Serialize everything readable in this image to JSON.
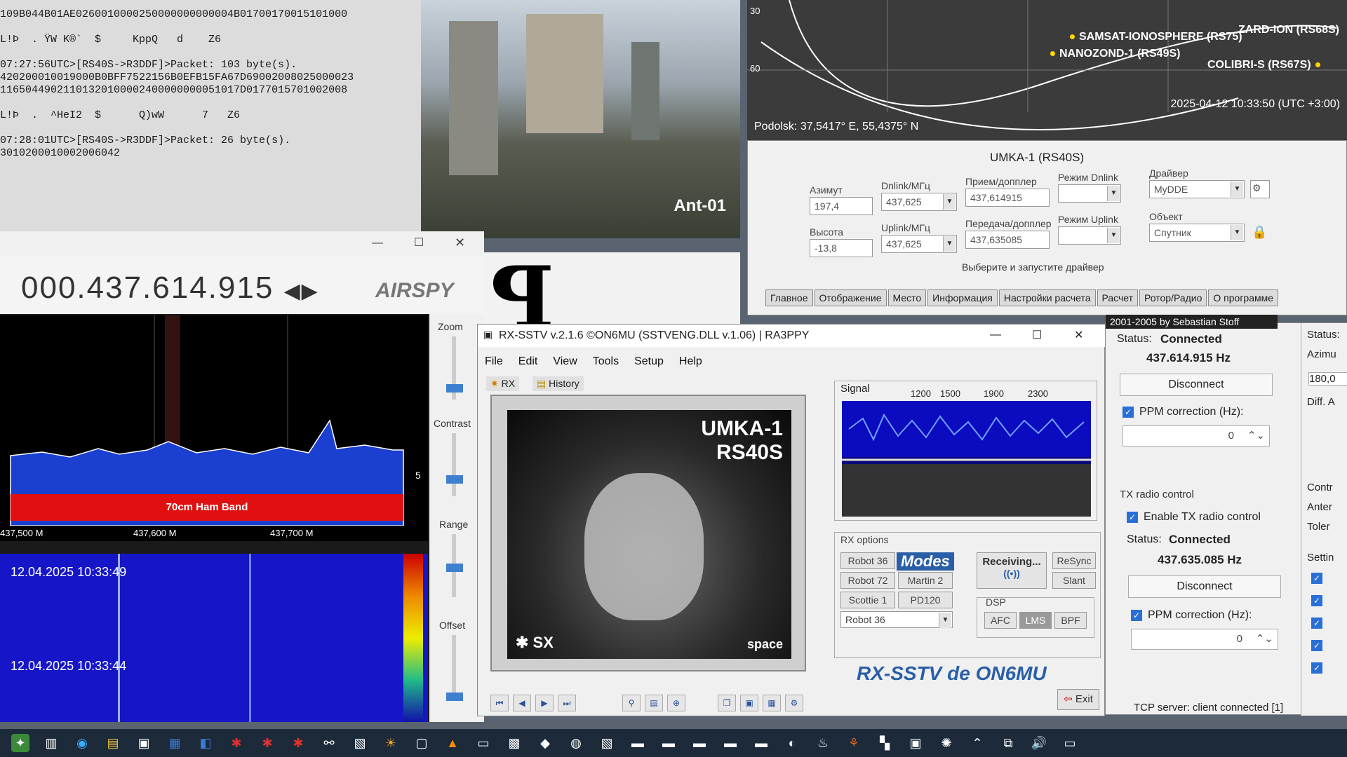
{
  "terminal": {
    "lines": [
      "109B044B01AE0260010000250000000000004B01700170015101000",
      "",
      "L!Þ  . ŸW K®`  $     KppQ   d    Z6",
      "",
      "07:27:56UTC>[RS40S->R3DDF]>Packet: 103 byte(s).",
      "420200010019000B0BFF7522156B0EFB15FA67D69002008025000023",
      "11650449021101320100002400000000051017D0177015701002008",
      "",
      "L!Þ  .  ^HeI2  $      Q)wW      7   Z6",
      "",
      "07:28:01UTC>[RS40S->R3DDF]>Packet: 26 byte(s).",
      "3010200010002006042"
    ]
  },
  "camera": {
    "label": "Ant-01"
  },
  "map": {
    "sats": [
      "SAMSAT-IONOSPHERE (RS75)",
      "NANOZOND-1 (RS49S)",
      "COLIBRI-S (RS67S)",
      "ZARD-ION (RS68S)"
    ],
    "axis_ticks": [
      "30",
      "60"
    ],
    "coords": "Podolsk: 37,5417° E, 55,4375° N",
    "timestamp": "2025-04-12 10:33:50 (UTC +3:00)"
  },
  "satpanel": {
    "title": "UMKA-1 (RS40S)",
    "azimuth_label": "Азимут",
    "azimuth": "197,4",
    "elevation_label": "Высота",
    "elevation": "-13,8",
    "dnlink_label": "Dnlink/МГц",
    "dnlink": "437,625",
    "uplink_label": "Uplink/МГц",
    "uplink": "437,625",
    "rx_doppler_label": "Прием/допплер",
    "rx_doppler": "437,614915",
    "tx_doppler_label": "Передача/допплер",
    "tx_doppler": "437,635085",
    "dn_mode_label": "Режим Dnlink",
    "up_mode_label": "Режим Uplink",
    "driver_label": "Драйвер",
    "driver": "MyDDE",
    "object_label": "Объект",
    "object": "Спутник",
    "hint": "Выберите и запустите драйвер",
    "tabs": [
      "Главное",
      "Отображение",
      "Место",
      "Информация",
      "Настройки расчета",
      "Расчет",
      "Ротор/Радио",
      "О программе"
    ]
  },
  "airspy": {
    "freq": "000.437.614.915",
    "logo": "AIRSPY",
    "axis": [
      "437,500 M",
      "437,600 M",
      "437,700 M"
    ],
    "band": "70cm Ham Band",
    "scale_right": "5",
    "wf_ts1": "12.04.2025 10:33:49",
    "wf_ts2": "12.04.2025 10:33:44",
    "controls": [
      "Zoom",
      "Contrast",
      "Range",
      "Offset"
    ]
  },
  "sstv": {
    "title": "RX-SSTV v.2.1.6 ©ON6MU (SSTVENG.DLL v.1.06) | RA3PPY",
    "menu": [
      "File",
      "Edit",
      "View",
      "Tools",
      "Setup",
      "Help"
    ],
    "rx": "RX",
    "history": "History",
    "img_line1": "UMKA-1",
    "img_line2": "RS40S",
    "img_sx": "SX",
    "img_space": "space",
    "signal_label": "Signal",
    "signal_ticks": [
      "1200",
      "1500",
      "1900",
      "2300"
    ],
    "rx_options": "RX options",
    "modes": [
      "Robot 36",
      "Robot 72",
      "Scottie 1",
      "Martin 2",
      "PD120"
    ],
    "modes_logo": "Modes",
    "mode_select": "Robot 36",
    "receiving": "Receiving...",
    "resync": "ReSync",
    "slant": "Slant",
    "dsp": "DSP",
    "afc": "AFC",
    "lms": "LMS",
    "bpf": "BPF",
    "logo": "RX-SSTV de ON6MU",
    "exit": "Exit"
  },
  "right": {
    "credit": "2001-2005 by Sebastian Stoff",
    "status_label": "Status:",
    "status": "Connected",
    "freq": "437.614.915 Hz",
    "disconnect": "Disconnect",
    "ppm_label": "PPM correction (Hz):",
    "ppm": "0",
    "tx_group": "TX radio control",
    "enable_tx": "Enable TX radio control",
    "tx_status": "Connected",
    "tx_freq": "437.635.085 Hz",
    "tx_disconnect": "Disconnect",
    "tx_ppm": "0",
    "tcp": "TCP server: client connected [1]",
    "edge": [
      "Status:",
      "Azimu",
      "180,0",
      "Diff. A",
      "Contr",
      "Anter",
      "Toler",
      "Settin"
    ]
  }
}
